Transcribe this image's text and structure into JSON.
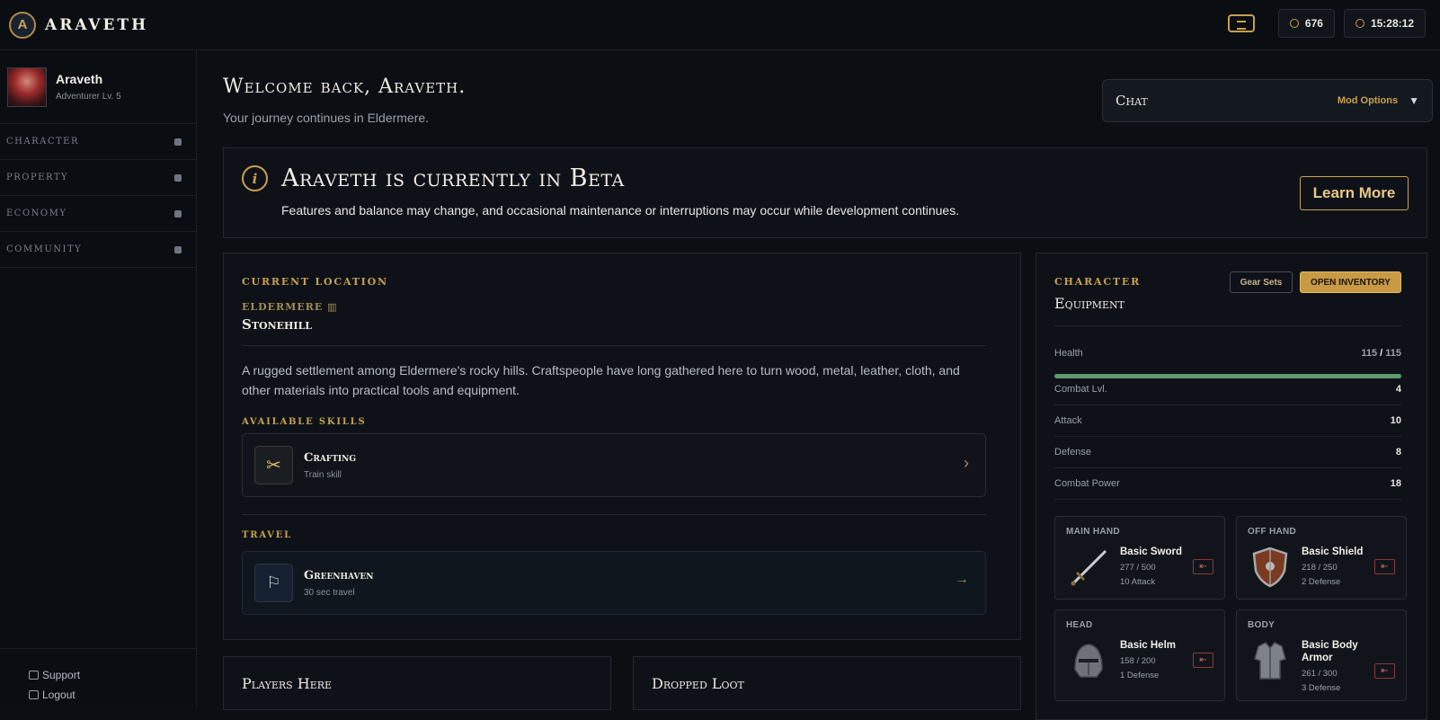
{
  "brand": {
    "name": "ARAVETH",
    "logo_letter": "A"
  },
  "topbar": {
    "coins": "676",
    "clock": "15:28:12"
  },
  "profile": {
    "name": "Araveth",
    "level": "Adventurer Lv. 5"
  },
  "nav": [
    {
      "label": "CHARACTER",
      "icon": "user-icon"
    },
    {
      "label": "PROPERTY",
      "icon": "box-icon"
    },
    {
      "label": "ECONOMY",
      "icon": "bank-icon"
    },
    {
      "label": "COMMUNITY",
      "icon": "users-icon"
    }
  ],
  "sidebar_bottom": {
    "support": "Support",
    "logout": "Logout"
  },
  "welcome": {
    "title": "Welcome back, Araveth.",
    "subtitle": "Your journey continues in Eldermere."
  },
  "chat": {
    "title": "Chat",
    "mod_options": "Mod Options"
  },
  "beta": {
    "title": "Araveth is currently in Beta",
    "text": "Features and balance may change, and occasional maintenance or interruptions may occur while development continues.",
    "button": "Learn More"
  },
  "location": {
    "heading": "CURRENT LOCATION",
    "region": "ELDERMERE",
    "city": "Stonehill",
    "description": "A rugged settlement among Eldermere's rocky hills. Craftspeople have long gathered here to turn wood, metal, leather, cloth, and other materials into practical tools and equipment.",
    "skills_heading": "AVAILABLE SKILLS",
    "skill": {
      "name": "Crafting",
      "sub": "Train skill"
    },
    "travel_heading": "TRAVEL",
    "travel": {
      "name": "Greenhaven",
      "sub": "30 sec travel"
    }
  },
  "equipment": {
    "heading": "CHARACTER",
    "title": "Equipment",
    "gear_sets": "Gear Sets",
    "open_inventory": "OPEN INVENTORY",
    "health_label": "Health",
    "health_value": "115",
    "health_sep": "/",
    "health_max": "115",
    "health_fraction": 1.0,
    "stats": [
      {
        "label": "Combat Lvl.",
        "value": "4"
      },
      {
        "label": "Attack",
        "value": "10"
      },
      {
        "label": "Defense",
        "value": "8"
      },
      {
        "label": "Combat Power",
        "value": "18"
      }
    ],
    "slots": [
      {
        "slot": "MAIN HAND",
        "name": "Basic Sword",
        "dur": "277 / 500",
        "stat": "10 Attack"
      },
      {
        "slot": "OFF HAND",
        "name": "Basic Shield",
        "dur": "218 / 250",
        "stat": "2 Defense"
      },
      {
        "slot": "HEAD",
        "name": "Basic Helm",
        "dur": "158 / 200",
        "stat": "1 Defense"
      },
      {
        "slot": "BODY",
        "name": "Basic Body Armor",
        "dur": "261 / 300",
        "stat": "3 Defense"
      }
    ]
  },
  "players_here": {
    "title": "Players Here"
  },
  "dropped_loot": {
    "title": "Dropped Loot"
  },
  "colors": {
    "accent": "#c9a04d",
    "bg": "#0b0f14",
    "health": "#5f9a6e"
  }
}
